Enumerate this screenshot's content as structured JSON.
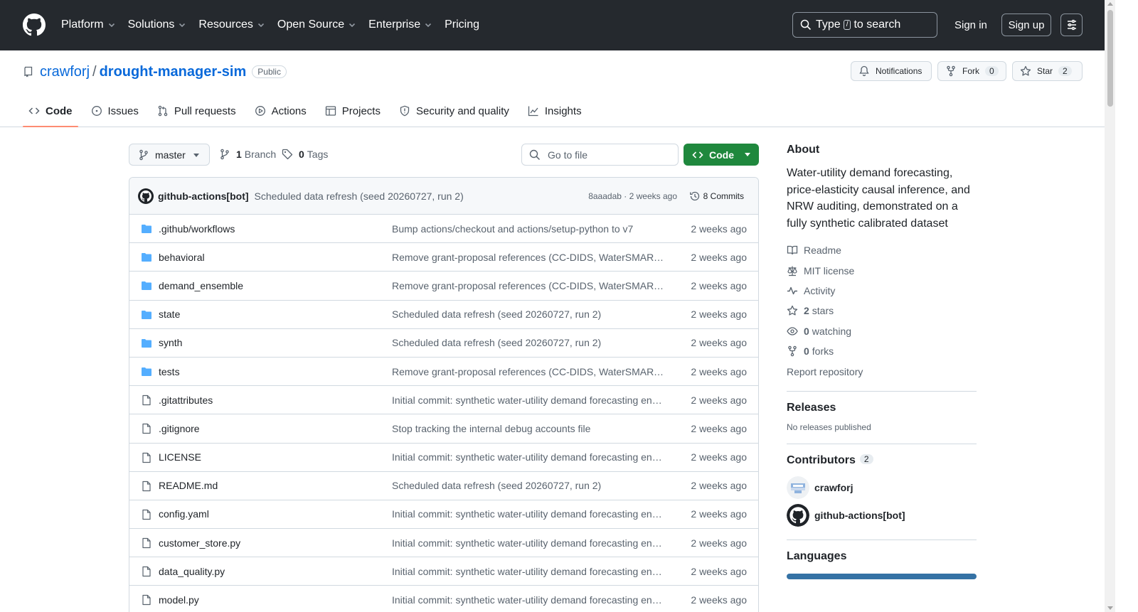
{
  "header": {
    "nav": [
      {
        "label": "Platform",
        "dropdown": true
      },
      {
        "label": "Solutions",
        "dropdown": true
      },
      {
        "label": "Resources",
        "dropdown": true
      },
      {
        "label": "Open Source",
        "dropdown": true
      },
      {
        "label": "Enterprise",
        "dropdown": true
      },
      {
        "label": "Pricing",
        "dropdown": false
      }
    ],
    "search": {
      "prefix": "Type",
      "key": "/",
      "suffix": "to search"
    },
    "sign_in": "Sign in",
    "sign_up": "Sign up"
  },
  "repo": {
    "owner": "crawforj",
    "separator": "/",
    "name": "drought-manager-sim",
    "visibility": "Public",
    "notifications_label": "Notifications",
    "fork_label": "Fork",
    "fork_count": "0",
    "star_label": "Star",
    "star_count": "2",
    "tabs": [
      {
        "label": "Code",
        "icon": "code-icon",
        "active": true
      },
      {
        "label": "Issues",
        "icon": "issue-icon",
        "active": false
      },
      {
        "label": "Pull requests",
        "icon": "pull-request-icon",
        "active": false
      },
      {
        "label": "Actions",
        "icon": "play-icon",
        "active": false
      },
      {
        "label": "Projects",
        "icon": "table-icon",
        "active": false
      },
      {
        "label": "Security and quality",
        "icon": "shield-icon",
        "active": false
      },
      {
        "label": "Insights",
        "icon": "graph-icon",
        "active": false
      }
    ]
  },
  "toolbar": {
    "branch": "master",
    "branch_count": "1",
    "branch_label": "Branch",
    "tag_count": "0",
    "tag_label": "Tags",
    "goto_placeholder": "Go to file",
    "code_label": "Code"
  },
  "latest_commit": {
    "author": "github-actions[bot]",
    "message": "Scheduled data refresh (seed 20260727, run 2)",
    "sha": "8aaadab",
    "sha_sep": "·",
    "time": "2 weeks ago",
    "commits_label": "8 Commits"
  },
  "files": [
    {
      "type": "dir",
      "name": ".github/workflows",
      "message": "Bump actions/checkout and actions/setup-python to v7",
      "date": "2 weeks ago"
    },
    {
      "type": "dir",
      "name": "behavioral",
      "message": "Remove grant-proposal references (CC-DIDS, WaterSMART…",
      "date": "2 weeks ago"
    },
    {
      "type": "dir",
      "name": "demand_ensemble",
      "message": "Remove grant-proposal references (CC-DIDS, WaterSMART…",
      "date": "2 weeks ago"
    },
    {
      "type": "dir",
      "name": "state",
      "message": "Scheduled data refresh (seed 20260727, run 2)",
      "date": "2 weeks ago"
    },
    {
      "type": "dir",
      "name": "synth",
      "message": "Scheduled data refresh (seed 20260727, run 2)",
      "date": "2 weeks ago"
    },
    {
      "type": "dir",
      "name": "tests",
      "message": "Remove grant-proposal references (CC-DIDS, WaterSMART…",
      "date": "2 weeks ago"
    },
    {
      "type": "file",
      "name": ".gitattributes",
      "message": "Initial commit: synthetic water-utility demand forecasting eng…",
      "date": "2 weeks ago"
    },
    {
      "type": "file",
      "name": ".gitignore",
      "message": "Stop tracking the internal debug accounts file",
      "date": "2 weeks ago"
    },
    {
      "type": "file",
      "name": "LICENSE",
      "message": "Initial commit: synthetic water-utility demand forecasting eng…",
      "date": "2 weeks ago"
    },
    {
      "type": "file",
      "name": "README.md",
      "message": "Scheduled data refresh (seed 20260727, run 2)",
      "date": "2 weeks ago"
    },
    {
      "type": "file",
      "name": "config.yaml",
      "message": "Initial commit: synthetic water-utility demand forecasting eng…",
      "date": "2 weeks ago"
    },
    {
      "type": "file",
      "name": "customer_store.py",
      "message": "Initial commit: synthetic water-utility demand forecasting eng…",
      "date": "2 weeks ago"
    },
    {
      "type": "file",
      "name": "data_quality.py",
      "message": "Initial commit: synthetic water-utility demand forecasting eng…",
      "date": "2 weeks ago"
    },
    {
      "type": "file",
      "name": "model.py",
      "message": "Initial commit: synthetic water-utility demand forecasting eng…",
      "date": "2 weeks ago"
    }
  ],
  "about": {
    "heading": "About",
    "description": "Water-utility demand forecasting, price-elasticity causal inference, and NRW auditing, demonstrated on a fully synthetic calibrated dataset",
    "links": [
      {
        "icon": "book-icon",
        "count": "",
        "label": "Readme"
      },
      {
        "icon": "law-icon",
        "count": "",
        "label": "MIT license"
      },
      {
        "icon": "pulse-icon",
        "count": "",
        "label": "Activity"
      },
      {
        "icon": "star-icon",
        "count": "2",
        "label": "stars"
      },
      {
        "icon": "eye-icon",
        "count": "0",
        "label": "watching"
      },
      {
        "icon": "fork-icon",
        "count": "0",
        "label": "forks"
      },
      {
        "icon": "",
        "count": "",
        "label": "Report repository"
      }
    ]
  },
  "releases": {
    "heading": "Releases",
    "empty": "No releases published"
  },
  "contributors": {
    "heading": "Contributors",
    "count": "2",
    "people": [
      {
        "name": "crawforj",
        "avatar": "identicon"
      },
      {
        "name": "github-actions[bot]",
        "avatar": "github-mark"
      }
    ]
  },
  "languages": {
    "heading": "Languages",
    "bar_color": "#3572a5"
  },
  "colors": {
    "header_bg": "#25292e",
    "link_blue": "#0969da",
    "code_green": "#1f883d",
    "tab_underline": "#fd8c73",
    "folder_blue": "#54aeff"
  }
}
